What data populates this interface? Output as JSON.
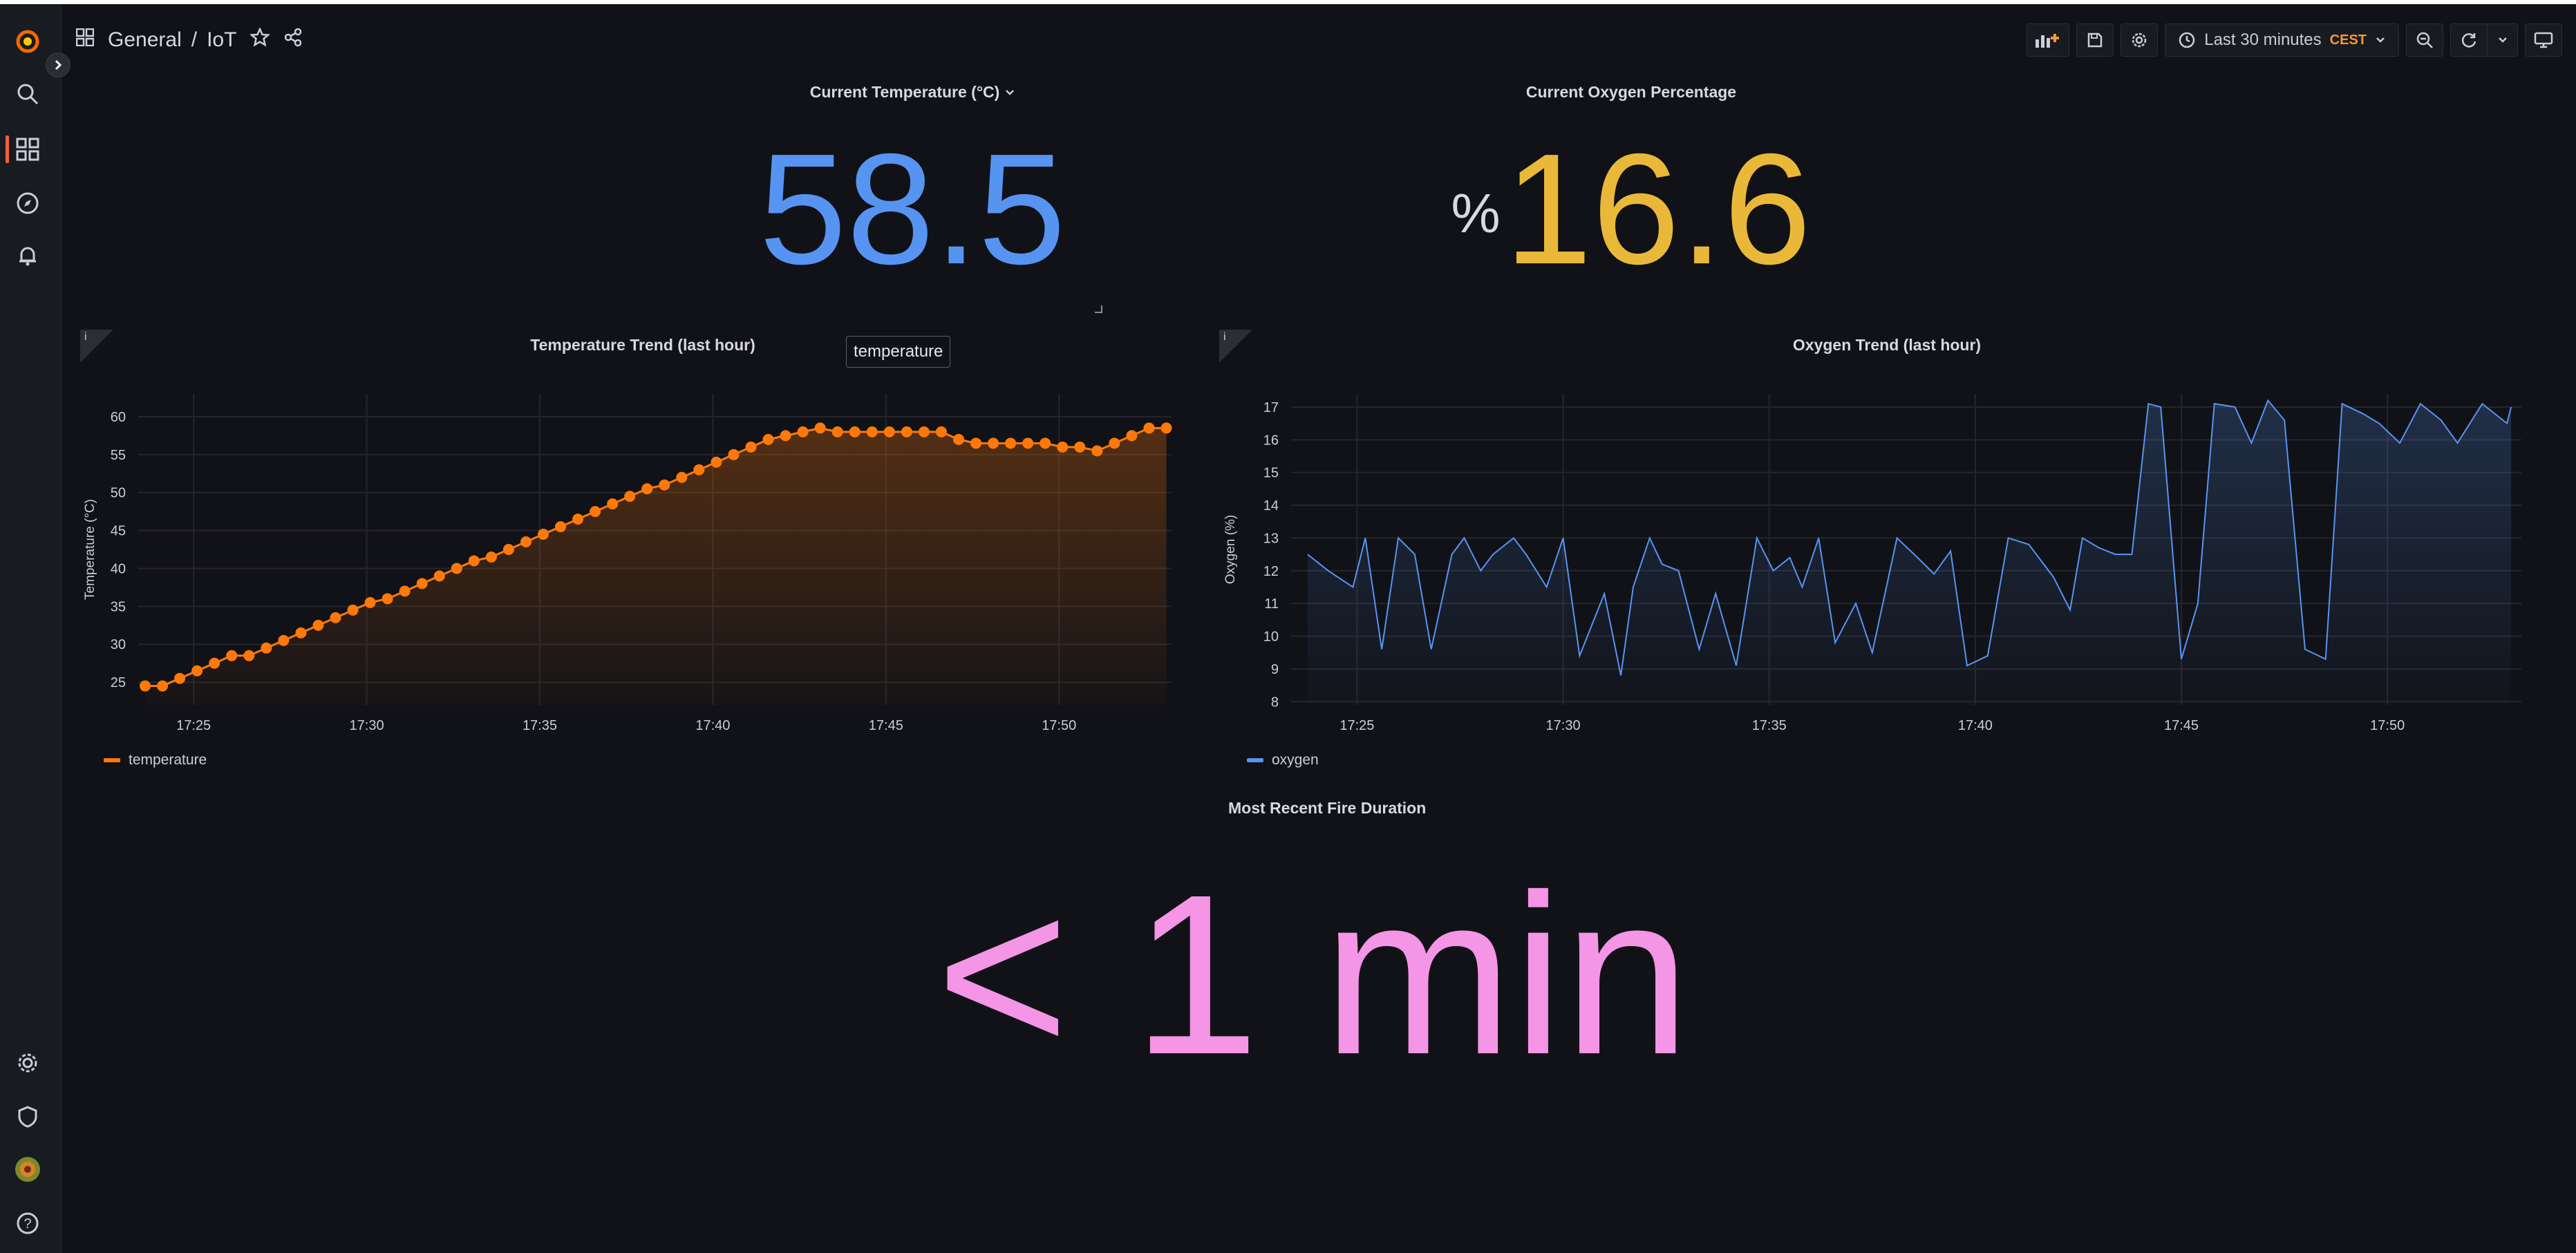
{
  "header": {
    "breadcrumb_folder": "General",
    "breadcrumb_sep": "/",
    "breadcrumb_dashboard": "IoT"
  },
  "toolbar": {
    "time_range": "Last 30 minutes",
    "timezone": "CEST"
  },
  "sidebar": {
    "items": [
      "grafana-logo",
      "search-icon",
      "dashboards-icon",
      "explore-icon",
      "alerting-icon",
      "settings-icon",
      "shield-icon",
      "avatar",
      "help-icon"
    ]
  },
  "panels": {
    "temp_stat": {
      "title": "Current Temperature (°C)",
      "value": "58.5",
      "color": "#5794f2"
    },
    "oxygen_stat": {
      "title": "Current Oxygen Percentage",
      "unit": "%",
      "value": "16.6",
      "color": "#eab839"
    },
    "fire_stat": {
      "title": "Most Recent Fire Duration",
      "value": "< 1 min",
      "color": "#f495e6"
    },
    "temp_trend": {
      "title": "Temperature Trend (last hour)",
      "info": "i",
      "tooltip": "temperature",
      "legend": "temperature",
      "ylabel": "Temperature (°C)"
    },
    "oxygen_trend": {
      "title": "Oxygen Trend (last hour)",
      "info": "i",
      "legend": "oxygen",
      "ylabel": "Oxygen (%)"
    }
  },
  "chart_data": [
    {
      "type": "line",
      "title": "Temperature Trend (last hour)",
      "ylabel": "Temperature (°C)",
      "xticks": [
        "17:25",
        "17:30",
        "17:35",
        "17:40",
        "17:45",
        "17:50"
      ],
      "yticks": [
        25,
        30,
        35,
        40,
        45,
        50,
        55,
        60
      ],
      "xlim_min": [
        23.4,
        53.25
      ],
      "ylim": [
        22,
        63
      ],
      "series": [
        {
          "name": "temperature",
          "color": "#ff780a",
          "x_min": [
            23.6,
            24.1,
            24.6,
            25.1,
            25.6,
            26.1,
            26.6,
            27.1,
            27.6,
            28.1,
            28.6,
            29.1,
            29.6,
            30.1,
            30.6,
            31.1,
            31.6,
            32.1,
            32.6,
            33.1,
            33.6,
            34.1,
            34.6,
            35.1,
            35.6,
            36.1,
            36.6,
            37.1,
            37.6,
            38.1,
            38.6,
            39.1,
            39.6,
            40.1,
            40.6,
            41.1,
            41.6,
            42.1,
            42.6,
            43.1,
            43.6,
            44.1,
            44.6,
            45.1,
            45.6,
            46.1,
            46.6,
            47.1,
            47.6,
            48.1,
            48.6,
            49.1,
            49.6,
            50.1,
            50.6,
            51.1,
            51.6,
            52.1,
            52.6,
            53.1
          ],
          "values": [
            24.5,
            24.5,
            25.5,
            26.5,
            27.5,
            28.5,
            28.5,
            29.5,
            30.5,
            31.5,
            32.5,
            33.5,
            34.5,
            35.5,
            36,
            37,
            38,
            39,
            40,
            41,
            41.5,
            42.5,
            43.5,
            44.5,
            45.5,
            46.5,
            47.5,
            48.5,
            49.5,
            50.5,
            51,
            52,
            53,
            54,
            55,
            56,
            57,
            57.5,
            58,
            58.5,
            58,
            58,
            58,
            58,
            58,
            58,
            58,
            57,
            56.5,
            56.5,
            56.5,
            56.5,
            56.5,
            56,
            56,
            55.5,
            56.5,
            57.5,
            58.5,
            58.5
          ]
        }
      ]
    },
    {
      "type": "area",
      "title": "Oxygen Trend (last hour)",
      "ylabel": "Oxygen (%)",
      "xticks": [
        "17:25",
        "17:30",
        "17:35",
        "17:40",
        "17:45",
        "17:50"
      ],
      "yticks": [
        8,
        9,
        10,
        11,
        12,
        13,
        14,
        15,
        16,
        17
      ],
      "xlim_min": [
        23.4,
        53.25
      ],
      "ylim": [
        7.9,
        17.4
      ],
      "series": [
        {
          "name": "oxygen",
          "color": "#5794f2",
          "x_min": [
            23.8,
            24.3,
            24.9,
            25.2,
            25.6,
            26,
            26.4,
            26.8,
            27.3,
            27.6,
            28,
            28.3,
            28.8,
            29.1,
            29.6,
            30,
            30.4,
            31,
            31.4,
            31.7,
            32.1,
            32.4,
            32.8,
            33.3,
            33.7,
            34.2,
            34.7,
            35.1,
            35.5,
            35.8,
            36.2,
            36.6,
            37.1,
            37.5,
            38.1,
            38.6,
            39,
            39.4,
            39.8,
            40.3,
            40.8,
            41.3,
            41.9,
            42.3,
            42.6,
            43,
            43.4,
            43.8,
            44.2,
            44.5,
            45,
            45.4,
            45.8,
            46.3,
            46.7,
            47.1,
            47.5,
            48,
            48.5,
            48.9,
            49.4,
            49.8,
            50.3,
            50.8,
            51.3,
            51.7,
            52.3,
            52.9,
            53
          ],
          "values": [
            12.5,
            12,
            11.5,
            13,
            9.6,
            13,
            12.5,
            9.6,
            12.5,
            13,
            12,
            12.5,
            13,
            12.5,
            11.5,
            13,
            9.4,
            11.3,
            8.8,
            11.5,
            13,
            12.2,
            12,
            9.6,
            11.3,
            9.1,
            13,
            12,
            12.4,
            11.5,
            13,
            9.8,
            11,
            9.5,
            13,
            12.4,
            11.9,
            12.6,
            9.1,
            9.4,
            13,
            12.8,
            11.8,
            10.8,
            13,
            12.7,
            12.5,
            12.5,
            17.1,
            17,
            9.3,
            11,
            17.1,
            17,
            15.9,
            17.2,
            16.6,
            9.6,
            9.3,
            17.1,
            16.8,
            16.5,
            15.9,
            17.1,
            16.6,
            15.9,
            17.1,
            16.5,
            17
          ]
        }
      ]
    }
  ]
}
